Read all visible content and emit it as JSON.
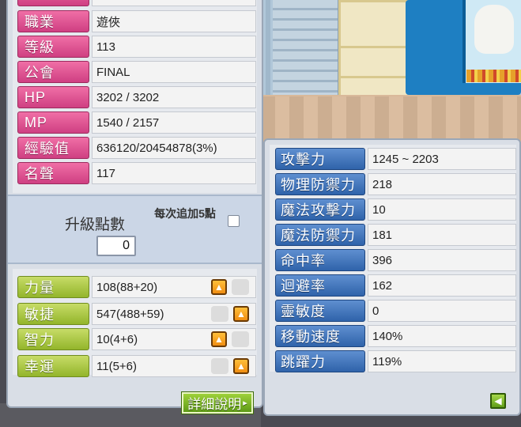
{
  "basic_info": [
    {
      "label": "職業",
      "value": "遊俠"
    },
    {
      "label": "等級",
      "value": "113"
    },
    {
      "label": "公會",
      "value": "FINAL"
    },
    {
      "label": "HP",
      "value": "3202 / 3202"
    },
    {
      "label": "MP",
      "value": "1540 / 2157"
    },
    {
      "label": "經驗值",
      "value": "636120/20454878(3%)"
    },
    {
      "label": "名聲",
      "value": "117"
    }
  ],
  "ability_points": {
    "label": "升級點數",
    "value": "0",
    "auto_add_label": "每次追加5點",
    "auto_add_checked": false
  },
  "stats": [
    {
      "label": "力量",
      "value": "108(88+20)",
      "up_icon": "arrow-up"
    },
    {
      "label": "敏捷",
      "value": "547(488+59)",
      "up_icon": "arrow-up"
    },
    {
      "label": "智力",
      "value": "10(4+6)",
      "up_icon": "arrow-up"
    },
    {
      "label": "幸運",
      "value": "11(5+6)",
      "up_icon": "arrow-up"
    }
  ],
  "detail_button": {
    "label": "詳細說明",
    "icon": "chevron-right"
  },
  "detail_stats": [
    {
      "label": "攻擊力",
      "value": "1245 ~ 2203"
    },
    {
      "label": "物理防禦力",
      "value": "218"
    },
    {
      "label": "魔法攻擊力",
      "value": "10"
    },
    {
      "label": "魔法防禦力",
      "value": "181"
    },
    {
      "label": "命中率",
      "value": "396"
    },
    {
      "label": "迴避率",
      "value": "162"
    },
    {
      "label": "靈敏度",
      "value": "0"
    },
    {
      "label": "移動速度",
      "value": "140%"
    },
    {
      "label": "跳躍力",
      "value": "119%"
    }
  ],
  "collapse_button": {
    "icon": "arrow-left"
  },
  "colors": {
    "info_label": "#d94a8c",
    "stat_label": "#a8c43c",
    "detail_label": "#3f73bd",
    "up_button": "#f5a020"
  }
}
